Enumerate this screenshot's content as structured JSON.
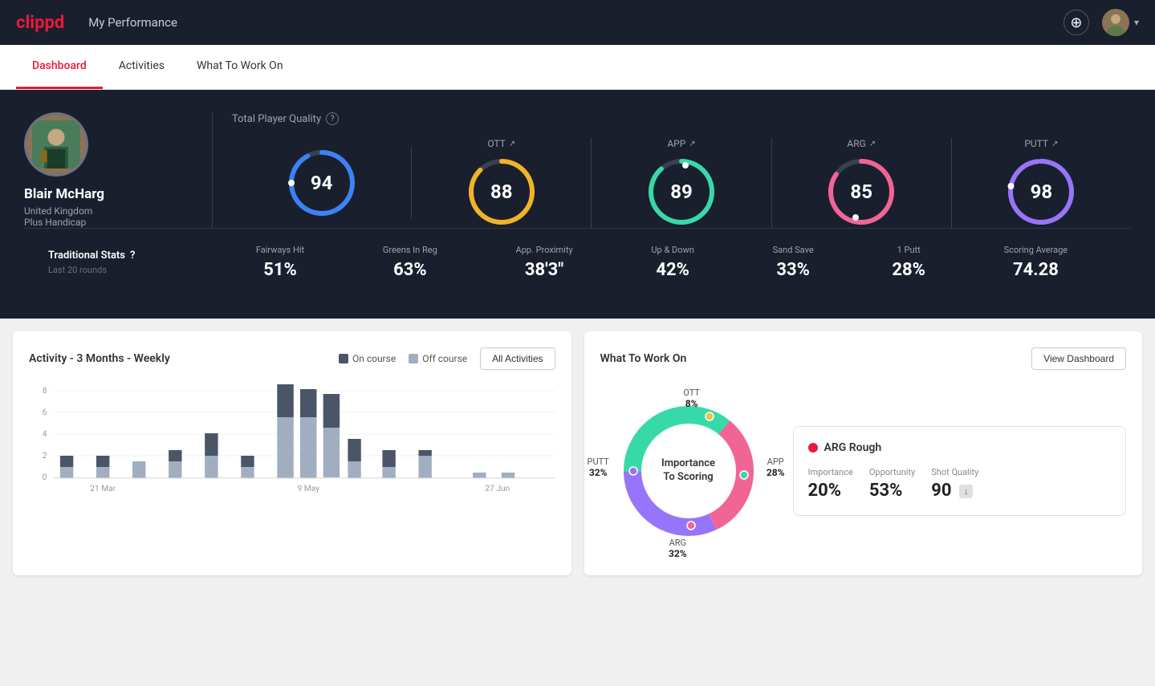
{
  "header": {
    "logo": "clippd",
    "title": "My Performance",
    "add_label": "+",
    "chevron": "▾"
  },
  "tabs": [
    {
      "id": "dashboard",
      "label": "Dashboard",
      "active": true
    },
    {
      "id": "activities",
      "label": "Activities",
      "active": false
    },
    {
      "id": "what-to-work-on",
      "label": "What To Work On",
      "active": false
    }
  ],
  "player": {
    "name": "Blair McHarg",
    "country": "United Kingdom",
    "handicap": "Plus Handicap"
  },
  "quality": {
    "label": "Total Player Quality",
    "main_score": "94",
    "gauges": [
      {
        "id": "ott",
        "label": "OTT",
        "value": "88",
        "color": "#f0b429",
        "pct": 88
      },
      {
        "id": "app",
        "label": "APP",
        "value": "89",
        "color": "#38d9a9",
        "pct": 89
      },
      {
        "id": "arg",
        "label": "ARG",
        "value": "85",
        "color": "#f06595",
        "pct": 85
      },
      {
        "id": "putt",
        "label": "PUTT",
        "value": "98",
        "color": "#9775fa",
        "pct": 98
      }
    ]
  },
  "stats": {
    "title": "Traditional Stats",
    "subtitle": "Last 20 rounds",
    "items": [
      {
        "name": "Fairways Hit",
        "value": "51%"
      },
      {
        "name": "Greens In Reg",
        "value": "63%"
      },
      {
        "name": "App. Proximity",
        "value": "38'3\""
      },
      {
        "name": "Up & Down",
        "value": "42%"
      },
      {
        "name": "Sand Save",
        "value": "33%"
      },
      {
        "name": "1 Putt",
        "value": "28%"
      },
      {
        "name": "Scoring Average",
        "value": "74.28"
      }
    ]
  },
  "activity_chart": {
    "title": "Activity - 3 Months - Weekly",
    "legend": [
      {
        "label": "On course",
        "color": "#4a5568"
      },
      {
        "label": "Off course",
        "color": "#a0aec0"
      }
    ],
    "button": "All Activities",
    "y_labels": [
      "8",
      "6",
      "4",
      "2",
      "0"
    ],
    "x_labels": [
      "21 Mar",
      "9 May",
      "27 Jun"
    ],
    "bars": [
      {
        "on": 1,
        "off": 1
      },
      {
        "on": 1,
        "off": 1
      },
      {
        "on": 0,
        "off": 1.5
      },
      {
        "on": 1,
        "off": 1.5
      },
      {
        "on": 2,
        "off": 2
      },
      {
        "on": 1,
        "off": 1
      },
      {
        "on": 3,
        "off": 5.5
      },
      {
        "on": 2.5,
        "off": 5.5
      },
      {
        "on": 3,
        "off": 4.5
      },
      {
        "on": 2,
        "off": 1.5
      },
      {
        "on": 1.5,
        "off": 1
      },
      {
        "on": 0.5,
        "off": 2
      },
      {
        "on": 0,
        "off": 0.5
      },
      {
        "on": 0,
        "off": 0.5
      }
    ]
  },
  "work_on": {
    "title": "What To Work On",
    "button": "View Dashboard",
    "donut_center": "Importance\nTo Scoring",
    "segments": [
      {
        "label": "OTT",
        "pct": "8%",
        "color": "#f0b429",
        "angle_start": 0,
        "angle_end": 29
      },
      {
        "label": "APP",
        "pct": "28%",
        "color": "#38d9a9",
        "angle_start": 29,
        "angle_end": 130
      },
      {
        "label": "ARG",
        "pct": "32%",
        "color": "#f06595",
        "angle_start": 130,
        "angle_end": 245
      },
      {
        "label": "PUTT",
        "pct": "32%",
        "color": "#9775fa",
        "angle_start": 245,
        "angle_end": 360
      }
    ],
    "card": {
      "title": "ARG Rough",
      "dot_color": "#e8193c",
      "metrics": [
        {
          "label": "Importance",
          "value": "20%"
        },
        {
          "label": "Opportunity",
          "value": "53%"
        },
        {
          "label": "Shot Quality",
          "value": "90",
          "badge": "↓"
        }
      ]
    }
  }
}
